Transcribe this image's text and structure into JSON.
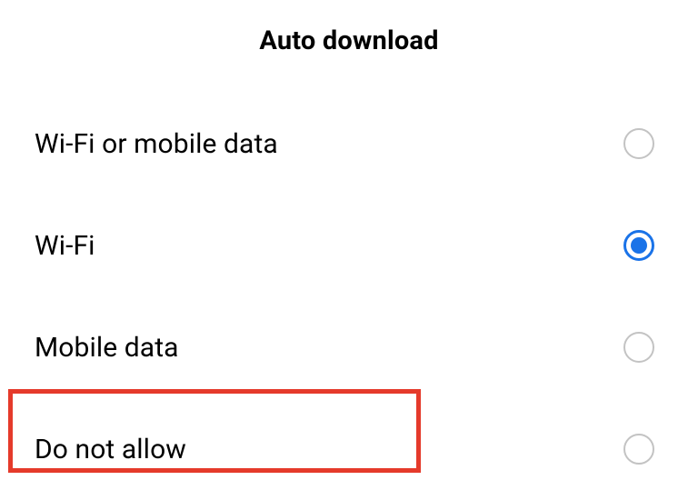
{
  "header": {
    "title": "Auto download"
  },
  "options": {
    "wifi_or_mobile": {
      "label": "Wi-Fi or mobile data",
      "selected": false
    },
    "wifi": {
      "label": "Wi-Fi",
      "selected": true
    },
    "mobile": {
      "label": "Mobile data",
      "selected": false
    },
    "deny": {
      "label": "Do not allow",
      "selected": false
    }
  },
  "highlight": {
    "target": "deny"
  }
}
